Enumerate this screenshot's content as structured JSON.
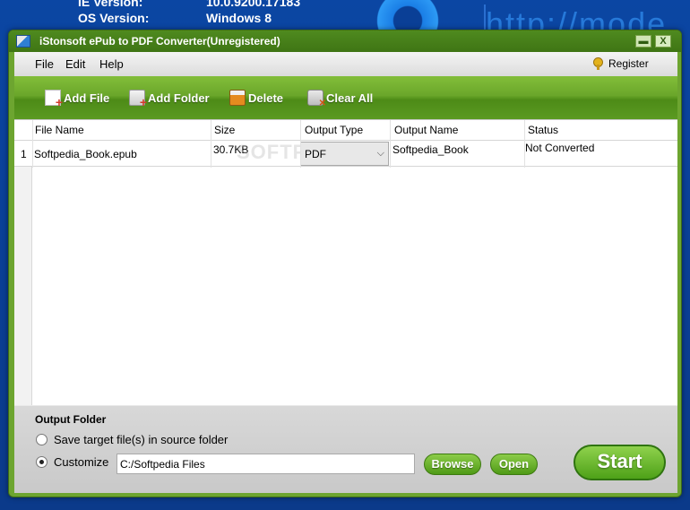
{
  "desktop": {
    "ie_version_label": "IE Version:",
    "ie_version_value": "10.0.9200.17183",
    "os_version_label": "OS Version:",
    "os_version_value": "Windows 8",
    "url_text": "http://mode"
  },
  "window": {
    "title": "iStonsoft ePub to PDF Converter(Unregistered)",
    "minimize_label": "▬",
    "close_label": "X"
  },
  "menu": {
    "file": "File",
    "edit": "Edit",
    "help": "Help",
    "register": "Register"
  },
  "toolbar": {
    "add_file": "Add File",
    "add_folder": "Add Folder",
    "delete": "Delete",
    "clear_all": "Clear All"
  },
  "table": {
    "headers": [
      "File Name",
      "Size",
      "Output Type",
      "Output Name",
      "Status"
    ],
    "rows": [
      {
        "num": "1",
        "file_name": "Softpedia_Book.epub",
        "size": "30.7KB",
        "output_type": "PDF",
        "output_name": "Softpedia_Book",
        "status": "Not Converted"
      }
    ],
    "watermark": "SOFTPEDIA"
  },
  "output": {
    "title": "Output Folder",
    "option_source": "Save target file(s) in source folder",
    "option_customize": "Customize",
    "path": "C:/Softpedia Files",
    "browse": "Browse",
    "open": "Open",
    "start": "Start"
  },
  "colors": {
    "accent_green": "#5b9a22",
    "desktop_blue": "#0b46a3"
  }
}
